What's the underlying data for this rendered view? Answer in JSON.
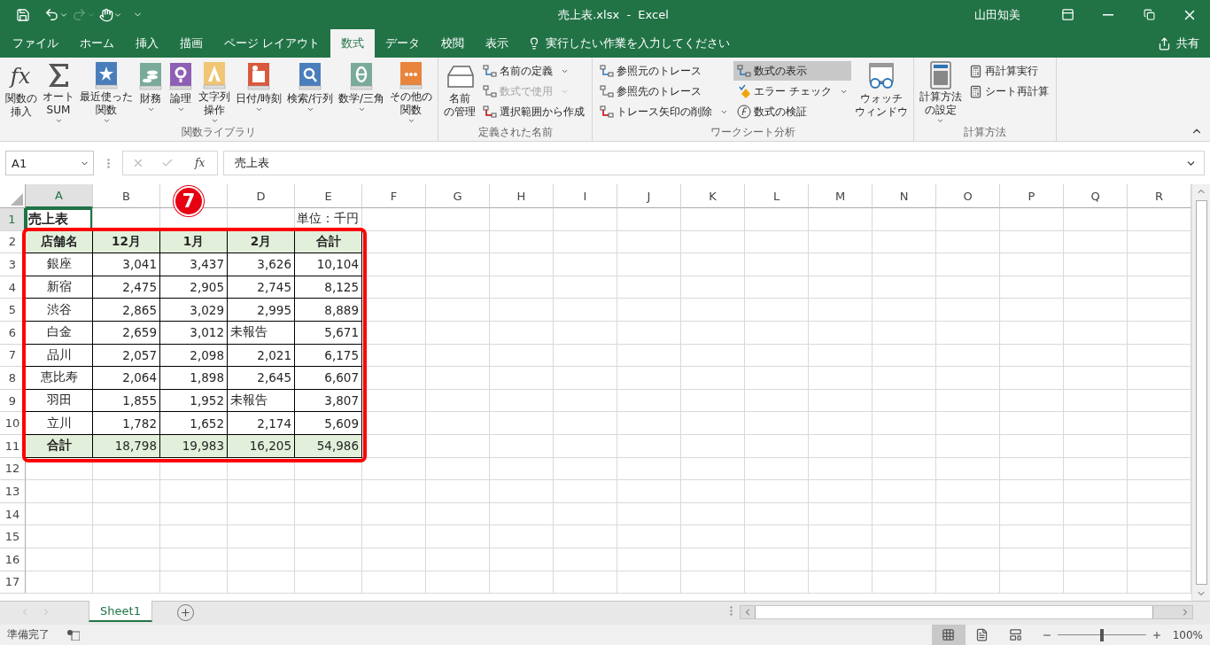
{
  "title_bar": {
    "title": "売上表.xlsx  -  Excel",
    "user": "山田知美"
  },
  "ribbon_tabs": [
    {
      "label": "ファイル",
      "selected": false
    },
    {
      "label": "ホーム",
      "selected": false
    },
    {
      "label": "挿入",
      "selected": false
    },
    {
      "label": "描画",
      "selected": false
    },
    {
      "label": "ページ レイアウト",
      "selected": false
    },
    {
      "label": "数式",
      "selected": true
    },
    {
      "label": "データ",
      "selected": false
    },
    {
      "label": "校閲",
      "selected": false
    },
    {
      "label": "表示",
      "selected": false
    }
  ],
  "tell_me": {
    "placeholder": "実行したい作業を入力してください"
  },
  "share": "共有",
  "ribbon": {
    "groups": [
      {
        "label": "関数ライブラリ",
        "items": [
          {
            "kind": "large",
            "symbol": "fx",
            "lines": [
              "関数の",
              "挿入"
            ],
            "dropdown": false
          },
          {
            "kind": "large",
            "lines": [
              "オート",
              "SUM"
            ],
            "dropdown": true
          },
          {
            "kind": "large",
            "lines": [
              "最近使った",
              "関数"
            ],
            "dropdown": true
          },
          {
            "kind": "large",
            "lines": [
              "財務"
            ],
            "dropdown": true
          },
          {
            "kind": "large",
            "lines": [
              "論理"
            ],
            "dropdown": true
          },
          {
            "kind": "large",
            "lines": [
              "文字列",
              "操作"
            ],
            "dropdown": true
          },
          {
            "kind": "large",
            "lines": [
              "日付/時刻"
            ],
            "dropdown": true
          },
          {
            "kind": "large",
            "lines": [
              "検索/行列"
            ],
            "dropdown": true
          },
          {
            "kind": "large",
            "lines": [
              "数学/三角"
            ],
            "dropdown": true
          },
          {
            "kind": "large",
            "lines": [
              "その他の",
              "関数"
            ],
            "dropdown": true
          }
        ]
      },
      {
        "label": "定義された名前",
        "items": [
          {
            "kind": "large",
            "lines": [
              "名前",
              "の管理"
            ],
            "dropdown": false
          },
          {
            "kind": "stack",
            "items": [
              {
                "label": "名前の定義",
                "dropdown": true,
                "disabled": false,
                "selected": false
              },
              {
                "label": "数式で使用",
                "dropdown": true,
                "disabled": true,
                "selected": false
              },
              {
                "label": "選択範囲から作成",
                "dropdown": false,
                "disabled": false,
                "selected": false
              }
            ]
          }
        ]
      },
      {
        "label": "ワークシート分析",
        "items": [
          {
            "kind": "stack",
            "items": [
              {
                "label": "参照元のトレース",
                "dropdown": false,
                "disabled": false,
                "selected": false
              },
              {
                "label": "参照先のトレース",
                "dropdown": false,
                "disabled": false,
                "selected": false
              },
              {
                "label": "トレース矢印の削除",
                "dropdown": true,
                "disabled": false,
                "selected": false
              }
            ]
          },
          {
            "kind": "stack",
            "items": [
              {
                "label": "数式の表示",
                "dropdown": false,
                "disabled": false,
                "selected": true
              },
              {
                "label": "エラー チェック",
                "dropdown": true,
                "disabled": false,
                "selected": false
              },
              {
                "label": "数式の検証",
                "dropdown": false,
                "disabled": false,
                "selected": false
              }
            ]
          },
          {
            "kind": "large",
            "lines": [
              "ウォッチ",
              "ウィンドウ"
            ],
            "dropdown": false
          }
        ]
      },
      {
        "label": "計算方法",
        "items": [
          {
            "kind": "large",
            "lines": [
              "計算方法",
              "の設定"
            ],
            "dropdown": true
          },
          {
            "kind": "stack",
            "items": [
              {
                "label": "再計算実行",
                "dropdown": false,
                "disabled": false,
                "selected": false
              },
              {
                "label": "シート再計算",
                "dropdown": false,
                "disabled": false,
                "selected": false
              }
            ]
          }
        ]
      }
    ]
  },
  "formula_bar": {
    "name_box": "A1",
    "fx": "fx",
    "value": "売上表"
  },
  "sheet": {
    "columns": [
      {
        "label": "A",
        "selected": true
      },
      {
        "label": "B",
        "selected": false
      },
      {
        "selected": false
      },
      {
        "label": "D",
        "selected": false
      },
      {
        "label": "E",
        "selected": false
      },
      {
        "label": "F",
        "selected": false
      },
      {
        "label": "G",
        "selected": false
      },
      {
        "label": "H",
        "selected": false
      },
      {
        "label": "I",
        "selected": false
      },
      {
        "label": "J",
        "selected": false
      },
      {
        "label": "K",
        "selected": false
      },
      {
        "label": "L",
        "selected": false
      },
      {
        "label": "M",
        "selected": false
      },
      {
        "label": "N",
        "selected": false
      },
      {
        "label": "O",
        "selected": false
      },
      {
        "label": "P",
        "selected": false
      },
      {
        "label": "Q",
        "selected": false
      },
      {
        "label": "R",
        "selected": false
      }
    ],
    "row_numbers": [
      {
        "label": "1",
        "selected": true
      },
      {
        "label": "2",
        "selected": false
      },
      {
        "label": "3",
        "selected": false
      },
      {
        "label": "4",
        "selected": false
      },
      {
        "label": "5",
        "selected": false
      },
      {
        "label": "6",
        "selected": false
      },
      {
        "label": "7",
        "selected": false
      },
      {
        "label": "8",
        "selected": false
      },
      {
        "label": "9",
        "selected": false
      },
      {
        "label": "10",
        "selected": false
      },
      {
        "label": "11",
        "selected": false
      },
      {
        "label": "12",
        "selected": false
      },
      {
        "label": "13",
        "selected": false
      },
      {
        "label": "14",
        "selected": false
      },
      {
        "label": "15",
        "selected": false
      },
      {
        "label": "16",
        "selected": false
      },
      {
        "label": "17",
        "selected": false
      }
    ],
    "title": {
      "text": "売上表",
      "selected": true
    },
    "unit": "単位：千円",
    "table": {
      "header": [
        "店舗名",
        "12月",
        "1月",
        "2月",
        "合計"
      ],
      "rows": [
        {
          "store": "銀座",
          "values": [
            {
              "text": "3,041",
              "kind": "number"
            },
            {
              "text": "3,437",
              "kind": "number"
            },
            {
              "text": "3,626",
              "kind": "number"
            },
            {
              "text": "10,104",
              "kind": "number"
            }
          ]
        },
        {
          "store": "新宿",
          "values": [
            {
              "text": "2,475",
              "kind": "number"
            },
            {
              "text": "2,905",
              "kind": "number"
            },
            {
              "text": "2,745",
              "kind": "number"
            },
            {
              "text": "8,125",
              "kind": "number"
            }
          ]
        },
        {
          "store": "渋谷",
          "values": [
            {
              "text": "2,865",
              "kind": "number"
            },
            {
              "text": "3,029",
              "kind": "number"
            },
            {
              "text": "2,995",
              "kind": "number"
            },
            {
              "text": "8,889",
              "kind": "number"
            }
          ]
        },
        {
          "store": "白金",
          "values": [
            {
              "text": "2,659",
              "kind": "number"
            },
            {
              "text": "3,012",
              "kind": "number"
            },
            {
              "text": "未報告",
              "kind": "text"
            },
            {
              "text": "5,671",
              "kind": "number"
            }
          ]
        },
        {
          "store": "品川",
          "values": [
            {
              "text": "2,057",
              "kind": "number"
            },
            {
              "text": "2,098",
              "kind": "number"
            },
            {
              "text": "2,021",
              "kind": "number"
            },
            {
              "text": "6,175",
              "kind": "number"
            }
          ]
        },
        {
          "store": "恵比寿",
          "values": [
            {
              "text": "2,064",
              "kind": "number"
            },
            {
              "text": "1,898",
              "kind": "number"
            },
            {
              "text": "2,645",
              "kind": "number"
            },
            {
              "text": "6,607",
              "kind": "number"
            }
          ]
        },
        {
          "store": "羽田",
          "values": [
            {
              "text": "1,855",
              "kind": "number"
            },
            {
              "text": "1,952",
              "kind": "number"
            },
            {
              "text": "未報告",
              "kind": "text"
            },
            {
              "text": "3,807",
              "kind": "number"
            }
          ]
        },
        {
          "store": "立川",
          "values": [
            {
              "text": "1,782",
              "kind": "number"
            },
            {
              "text": "1,652",
              "kind": "number"
            },
            {
              "text": "2,174",
              "kind": "number"
            },
            {
              "text": "5,609",
              "kind": "number"
            }
          ]
        }
      ],
      "total": {
        "label": "合計",
        "values": [
          {
            "text": "18,798",
            "kind": "number"
          },
          {
            "text": "19,983",
            "kind": "number"
          },
          {
            "text": "16,205",
            "kind": "number"
          },
          {
            "text": "54,986",
            "kind": "number"
          }
        ]
      }
    },
    "step_badge": "7"
  },
  "sheet_tabs": [
    {
      "label": "Sheet1",
      "selected": true
    }
  ],
  "status_bar": {
    "status": "準備完了",
    "views": [
      {
        "selected": true
      },
      {
        "selected": false
      },
      {
        "selected": false
      }
    ],
    "zoom": {
      "level": 0.5,
      "reading": "100%"
    }
  }
}
